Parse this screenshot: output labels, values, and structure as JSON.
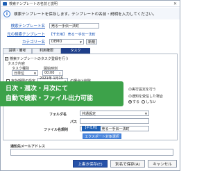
{
  "window": {
    "title": "検索テンプレートの名前と説明",
    "close_glyph": "✕"
  },
  "banner": {
    "text": "検索テンプレートを保存します。テンプレートの名前・説明を入力してください。"
  },
  "form": {
    "name_label": "検索テンプレート名",
    "name_value": "売る一手伝一法町",
    "source_label": "元の検索テンプレート",
    "source_tag": "【千年用】",
    "source_value": "売る一手伝一法町",
    "category_label": "カテゴリー名",
    "category_value": "DEMO",
    "new_button": "新規"
  },
  "tabs": [
    {
      "label": "説明・備考"
    },
    {
      "label": "利用権限"
    },
    {
      "label": "タスク"
    }
  ],
  "task": {
    "enable_label": "検索テンプレートのタスク登録を行う",
    "settings_heading": "タスク内容",
    "type_label": "タスク種別",
    "start_label": "開始時刻",
    "type_value": "日単位",
    "time_value": "00:00",
    "period_label": "有効期限の設定",
    "date_value": "2021年 1月15日",
    "right_text": "の場合は削除",
    "setting_note": "の実行設定を行う",
    "error_note": "の通知を受信した場合",
    "radio_a": "する",
    "radio_b": "しない",
    "folder_label": "フォルダ名",
    "folder_value": "共通設定",
    "path_label": "パス",
    "file_label": "ファイル名規則",
    "file_tag": "【千年用】",
    "file_value": "売る一手伝一法町",
    "export_button": "エクスポート対象選択"
  },
  "notify": {
    "label": "通知先メールアドレス"
  },
  "overlay": {
    "line1": "日次・週次・月次にて",
    "line2": "自動で検索・ファイル出力可能"
  },
  "footer": {
    "overwrite": "上書き保存(E)",
    "save_as": "別名で保存(A)",
    "cancel": "キャンセル"
  }
}
